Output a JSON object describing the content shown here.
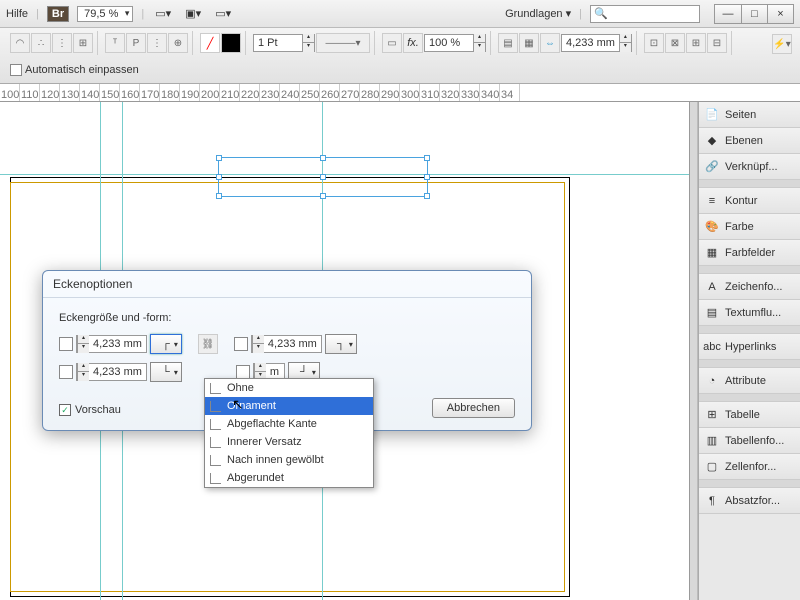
{
  "menubar": {
    "help": "Hilfe",
    "br": "Br",
    "zoom": "79,5 %",
    "workspace": "Grundlagen",
    "search_icon": "🔍"
  },
  "toolbar": {
    "stroke": "1 Pt",
    "scale": "100 %",
    "size": "4,233 mm",
    "autofit": "Automatisch einpassen"
  },
  "ruler": [
    "100",
    "110",
    "120",
    "130",
    "140",
    "150",
    "160",
    "170",
    "180",
    "190",
    "200",
    "210",
    "220",
    "230",
    "240",
    "250",
    "260",
    "270",
    "280",
    "290",
    "300",
    "310",
    "320",
    "330",
    "340",
    "34"
  ],
  "panels": [
    {
      "icon": "📄",
      "label": "Seiten"
    },
    {
      "icon": "◆",
      "label": "Ebenen"
    },
    {
      "icon": "🔗",
      "label": "Verknüpf..."
    },
    {
      "sep": true
    },
    {
      "icon": "≡",
      "label": "Kontur"
    },
    {
      "icon": "🎨",
      "label": "Farbe"
    },
    {
      "icon": "▦",
      "label": "Farbfelder"
    },
    {
      "sep": true
    },
    {
      "icon": "A",
      "label": "Zeichenfo..."
    },
    {
      "icon": "▤",
      "label": "Textumflu..."
    },
    {
      "sep": true
    },
    {
      "icon": "abc",
      "label": "Hyperlinks"
    },
    {
      "sep": true
    },
    {
      "icon": "◔",
      "label": "Attribute"
    },
    {
      "sep": true
    },
    {
      "icon": "⊞",
      "label": "Tabelle"
    },
    {
      "icon": "▥",
      "label": "Tabellenfo..."
    },
    {
      "icon": "▢",
      "label": "Zellenfor..."
    },
    {
      "sep": true
    },
    {
      "icon": "¶",
      "label": "Absatzfor..."
    }
  ],
  "dialog": {
    "title": "Eckenoptionen",
    "label": "Eckengröße und -form:",
    "val": "4,233 mm",
    "cancel": "Abbrechen",
    "preview": "Vorschau"
  },
  "dropdown": [
    "Ohne",
    "Ornament",
    "Abgeflachte Kante",
    "Innerer Versatz",
    "Nach innen gewölbt",
    "Abgerundet"
  ],
  "chart_data": null
}
